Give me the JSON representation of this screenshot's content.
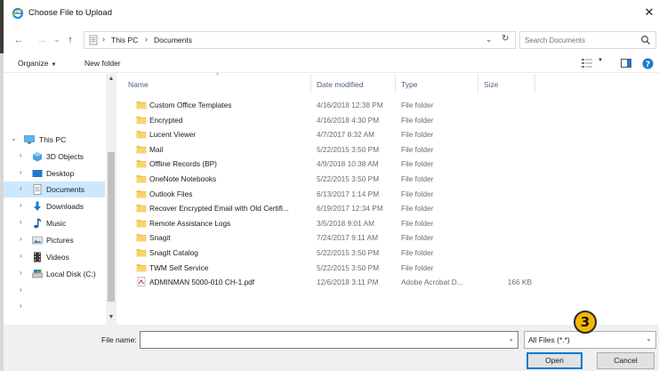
{
  "window": {
    "title": "Choose File to Upload",
    "close_glyph": "✕"
  },
  "address": {
    "back_glyph": "←",
    "forward_glyph": "→",
    "recent_glyph": "⌄",
    "up_glyph": "↑",
    "crumbs": [
      "This PC",
      "Documents"
    ],
    "separator": "›",
    "dropdown_glyph": "⌄",
    "refresh_glyph": "↻"
  },
  "search": {
    "placeholder": "Search Documents"
  },
  "toolbar": {
    "organize_label": "Organize",
    "organize_caret": "▼",
    "new_folder_label": "New folder",
    "view_caret": "▼"
  },
  "nav": {
    "scroll_up": "▲",
    "scroll_down": "▼",
    "items": [
      {
        "label": "This PC",
        "expander": "⌄",
        "icon": "computer-icon"
      },
      {
        "label": "3D Objects",
        "expander": "›",
        "icon": "cube-folder-icon"
      },
      {
        "label": "Desktop",
        "expander": "›",
        "icon": "desktop-folder-icon"
      },
      {
        "label": "Documents",
        "expander": "›",
        "icon": "documents-folder-icon"
      },
      {
        "label": "Downloads",
        "expander": "›",
        "icon": "download-arrow-icon"
      },
      {
        "label": "Music",
        "expander": "›",
        "icon": "music-note-icon"
      },
      {
        "label": "Pictures",
        "expander": "›",
        "icon": "pictures-folder-icon"
      },
      {
        "label": "Videos",
        "expander": "›",
        "icon": "film-strip-icon"
      },
      {
        "label": "Local Disk (C:)",
        "expander": "›",
        "icon": "hard-drive-icon"
      },
      {
        "label": "",
        "expander": "›",
        "icon": ""
      },
      {
        "label": "",
        "expander": "›",
        "icon": ""
      }
    ]
  },
  "columns": {
    "sort_glyph": "^",
    "name": "Name",
    "date": "Date modified",
    "type": "Type",
    "size": "Size"
  },
  "files": [
    {
      "name": "Custom Office Templates",
      "date": "4/16/2018 12:38 PM",
      "type": "File folder",
      "size": "",
      "icon": "folder-icon"
    },
    {
      "name": "Encrypted",
      "date": "4/16/2018 4:30 PM",
      "type": "File folder",
      "size": "",
      "icon": "folder-icon"
    },
    {
      "name": "Lucent Viewer",
      "date": "4/7/2017 8:32 AM",
      "type": "File folder",
      "size": "",
      "icon": "folder-icon"
    },
    {
      "name": "Mail",
      "date": "5/22/2015 3:50 PM",
      "type": "File folder",
      "size": "",
      "icon": "folder-icon"
    },
    {
      "name": "Offline Records (BP)",
      "date": "4/9/2018 10:38 AM",
      "type": "File folder",
      "size": "",
      "icon": "folder-icon"
    },
    {
      "name": "OneNote Notebooks",
      "date": "5/22/2015 3:50 PM",
      "type": "File folder",
      "size": "",
      "icon": "folder-icon"
    },
    {
      "name": "Outlook Files",
      "date": "6/13/2017 1:14 PM",
      "type": "File folder",
      "size": "",
      "icon": "folder-icon"
    },
    {
      "name": "Recover Encrypted Email with Old Certifi...",
      "date": "6/19/2017 12:34 PM",
      "type": "File folder",
      "size": "",
      "icon": "folder-icon"
    },
    {
      "name": "Remote Assistance Logs",
      "date": "3/5/2018 9:01 AM",
      "type": "File folder",
      "size": "",
      "icon": "folder-icon"
    },
    {
      "name": "Snagit",
      "date": "7/24/2017 9:11 AM",
      "type": "File folder",
      "size": "",
      "icon": "folder-icon"
    },
    {
      "name": "SnagIt Catalog",
      "date": "5/22/2015 3:50 PM",
      "type": "File folder",
      "size": "",
      "icon": "folder-icon"
    },
    {
      "name": "TWM Self Service",
      "date": "5/22/2015 3:50 PM",
      "type": "File folder",
      "size": "",
      "icon": "folder-icon"
    },
    {
      "name": "ADMINMAN 5000-010 CH-1.pdf",
      "date": "12/6/2018 3:11 PM",
      "type": "Adobe Acrobat D...",
      "size": "166 KB",
      "icon": "pdf-file-icon"
    }
  ],
  "footer": {
    "file_name_label": "File name:",
    "file_name_value": "",
    "file_name_dropdown": "⌄",
    "file_type_value": "All Files (*.*)",
    "file_type_caret": "⌄",
    "open_label": "Open",
    "cancel_label": "Cancel"
  },
  "callout": {
    "number": "3"
  },
  "colors": {
    "folder": "#f2c14e",
    "selection": "#cce8ff",
    "accent": "#0078d7",
    "callout": "#f5b800"
  }
}
